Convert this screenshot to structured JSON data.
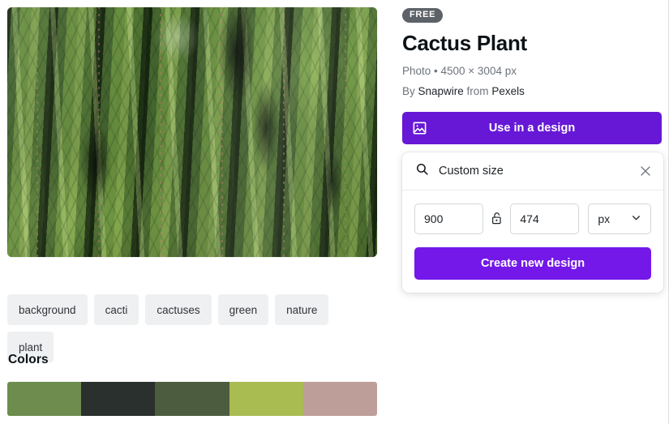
{
  "media": {
    "badge": "FREE",
    "title": "Cactus Plant",
    "meta": "Photo • 4500 × 3004 px",
    "credit_prefix": "By ",
    "author": "Snapwire",
    "credit_middle": " from ",
    "source": "Pexels",
    "image_alt": "cactus-plant-photo"
  },
  "actions": {
    "use_in_design": "Use in a design"
  },
  "popup": {
    "search_value": "Custom size",
    "search_placeholder": "Custom size",
    "width_value": "900",
    "height_value": "474",
    "unit_value": "px",
    "create_label": "Create new design",
    "lock_state": "unlocked"
  },
  "tags": [
    {
      "label": "background"
    },
    {
      "label": "cacti"
    },
    {
      "label": "cactuses"
    },
    {
      "label": "green"
    },
    {
      "label": "nature"
    },
    {
      "label": "plant"
    }
  ],
  "colors": {
    "heading": "Colors",
    "swatches": [
      {
        "hex": "#6D8C4E"
      },
      {
        "hex": "#2A302E"
      },
      {
        "hex": "#4B5D3E"
      },
      {
        "hex": "#A8BC52"
      },
      {
        "hex": "#BD9E99"
      }
    ]
  },
  "theme": {
    "accent": "#6618D6",
    "accent_bright": "#7318E8",
    "badge_bg": "#5D6268",
    "tag_bg": "#EFF0F1",
    "text_primary": "#0D1216",
    "text_muted": "#6E747C"
  }
}
